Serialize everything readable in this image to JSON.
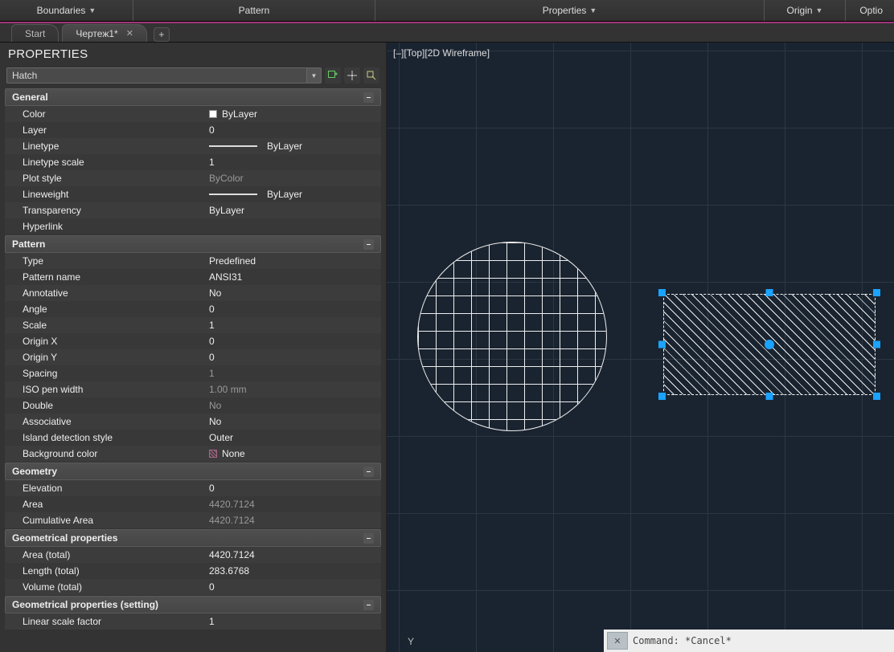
{
  "ribbon": {
    "boundaries": "Boundaries",
    "pattern": "Pattern",
    "properties": "Properties",
    "origin": "Origin",
    "options": "Optio"
  },
  "tabs": {
    "start": "Start",
    "doc": "Чертеж1*",
    "plus": "+"
  },
  "panelTitle": "PROPERTIES",
  "selection": "Hatch",
  "viewport": {
    "label": "[–][Top][2D Wireframe]",
    "axisY": "Y"
  },
  "command": {
    "text": "Command: *Cancel*"
  },
  "sections": {
    "general": {
      "title": "General",
      "rows": [
        {
          "l": "Color",
          "r": "ByLayer",
          "swatch": true
        },
        {
          "l": "Layer",
          "r": "0"
        },
        {
          "l": "Linetype",
          "r": "ByLayer",
          "line": true
        },
        {
          "l": "Linetype scale",
          "r": "1"
        },
        {
          "l": "Plot style",
          "r": "ByColor",
          "dim": true
        },
        {
          "l": "Lineweight",
          "r": "ByLayer",
          "line": true
        },
        {
          "l": "Transparency",
          "r": "ByLayer"
        },
        {
          "l": "Hyperlink",
          "r": ""
        }
      ]
    },
    "pattern": {
      "title": "Pattern",
      "rows": [
        {
          "l": "Type",
          "r": "Predefined"
        },
        {
          "l": "Pattern name",
          "r": "ANSI31"
        },
        {
          "l": "Annotative",
          "r": "No"
        },
        {
          "l": "Angle",
          "r": "0"
        },
        {
          "l": "Scale",
          "r": "1"
        },
        {
          "l": "Origin X",
          "r": "0"
        },
        {
          "l": "Origin Y",
          "r": "0"
        },
        {
          "l": "Spacing",
          "r": "1",
          "dim": true
        },
        {
          "l": "ISO pen width",
          "r": "1.00 mm",
          "dim": true
        },
        {
          "l": "Double",
          "r": "No",
          "dim": true
        },
        {
          "l": "Associative",
          "r": "No"
        },
        {
          "l": "Island detection style",
          "r": "Outer"
        },
        {
          "l": "Background color",
          "r": "None",
          "chk": true
        }
      ]
    },
    "geometry": {
      "title": "Geometry",
      "rows": [
        {
          "l": "Elevation",
          "r": "0"
        },
        {
          "l": "Area",
          "r": "4420.7124",
          "dim": true
        },
        {
          "l": "Cumulative Area",
          "r": "4420.7124",
          "dim": true
        }
      ]
    },
    "geoprops": {
      "title": "Geometrical properties",
      "rows": [
        {
          "l": "Area (total)",
          "r": "4420.7124"
        },
        {
          "l": "Length (total)",
          "r": "283.6768"
        },
        {
          "l": "Volume (total)",
          "r": "0"
        }
      ]
    },
    "geopset": {
      "title": "Geometrical properties (setting)",
      "rows": [
        {
          "l": "Linear scale factor",
          "r": "1"
        }
      ]
    }
  }
}
